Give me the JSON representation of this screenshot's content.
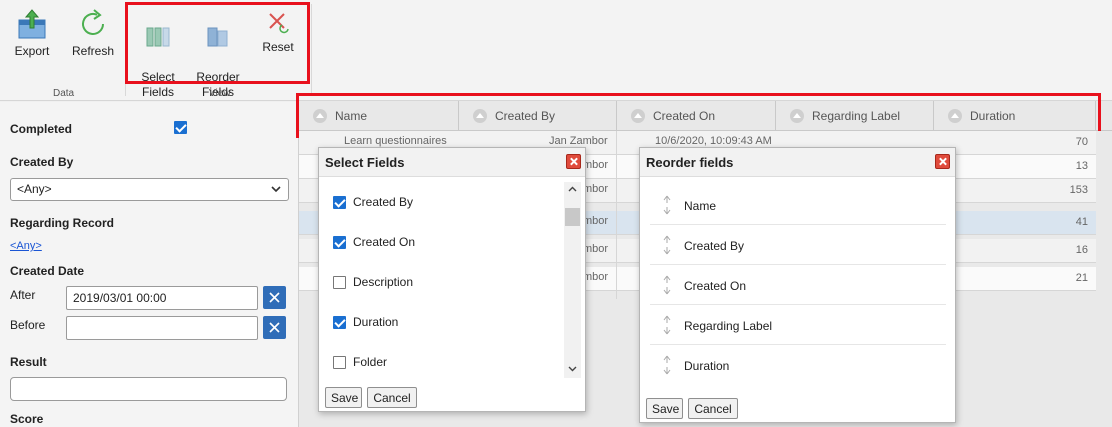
{
  "ribbon": {
    "groups": [
      {
        "label": "Data",
        "buttons": [
          {
            "label": "Export",
            "icon": "export-icon"
          },
          {
            "label": "Refresh",
            "icon": "refresh-icon"
          }
        ]
      },
      {
        "label": "View",
        "buttons": [
          {
            "label": "Select\nFields",
            "icon": "select-fields-icon"
          },
          {
            "label": "Reorder\nFields",
            "icon": "reorder-fields-icon"
          },
          {
            "label": "Reset",
            "icon": "reset-icon"
          }
        ]
      }
    ]
  },
  "filters": {
    "completed_label": "Completed",
    "completed_checked": true,
    "created_by_label": "Created By",
    "created_by_value": "<Any>",
    "regarding_label": "Regarding Record",
    "regarding_value": "<Any>",
    "created_date_label": "Created Date",
    "after_label": "After",
    "after_value": "2019/03/01 00:00",
    "before_label": "Before",
    "before_value": "",
    "result_label": "Result",
    "result_value": "",
    "score_label": "Score"
  },
  "grid": {
    "columns": [
      "Name",
      "Created By",
      "Created On",
      "Regarding Label",
      "Duration"
    ],
    "rows": [
      {
        "name": "Learn questionnaires",
        "created_by": "Jan Zambor",
        "created_on": "10/6/2020, 10:09:43 AM",
        "duration": "70"
      },
      {
        "name": "",
        "created_by": "mbor",
        "created_on": "",
        "duration": "13"
      },
      {
        "name": "",
        "created_by": "mbor",
        "created_on": "",
        "duration": "153"
      },
      {
        "name": "",
        "created_by": "mbor",
        "created_on": "",
        "duration": "41"
      },
      {
        "name": "",
        "created_by": "mbor",
        "created_on": "",
        "duration": "16"
      },
      {
        "name": "",
        "created_by": "mbor",
        "created_on": "",
        "duration": "21"
      }
    ]
  },
  "select_fields_dialog": {
    "title": "Select Fields",
    "fields": [
      {
        "label": "Created By",
        "checked": true
      },
      {
        "label": "Created On",
        "checked": true
      },
      {
        "label": "Description",
        "checked": false
      },
      {
        "label": "Duration",
        "checked": true
      },
      {
        "label": "Folder",
        "checked": false
      }
    ],
    "save_label": "Save",
    "cancel_label": "Cancel"
  },
  "reorder_dialog": {
    "title": "Reorder fields",
    "fields": [
      "Name",
      "Created By",
      "Created On",
      "Regarding Label",
      "Duration"
    ],
    "save_label": "Save",
    "cancel_label": "Cancel"
  },
  "colors": {
    "highlight": "#e8101c",
    "accent": "#1a6fd1",
    "close": "#e04b3c"
  }
}
